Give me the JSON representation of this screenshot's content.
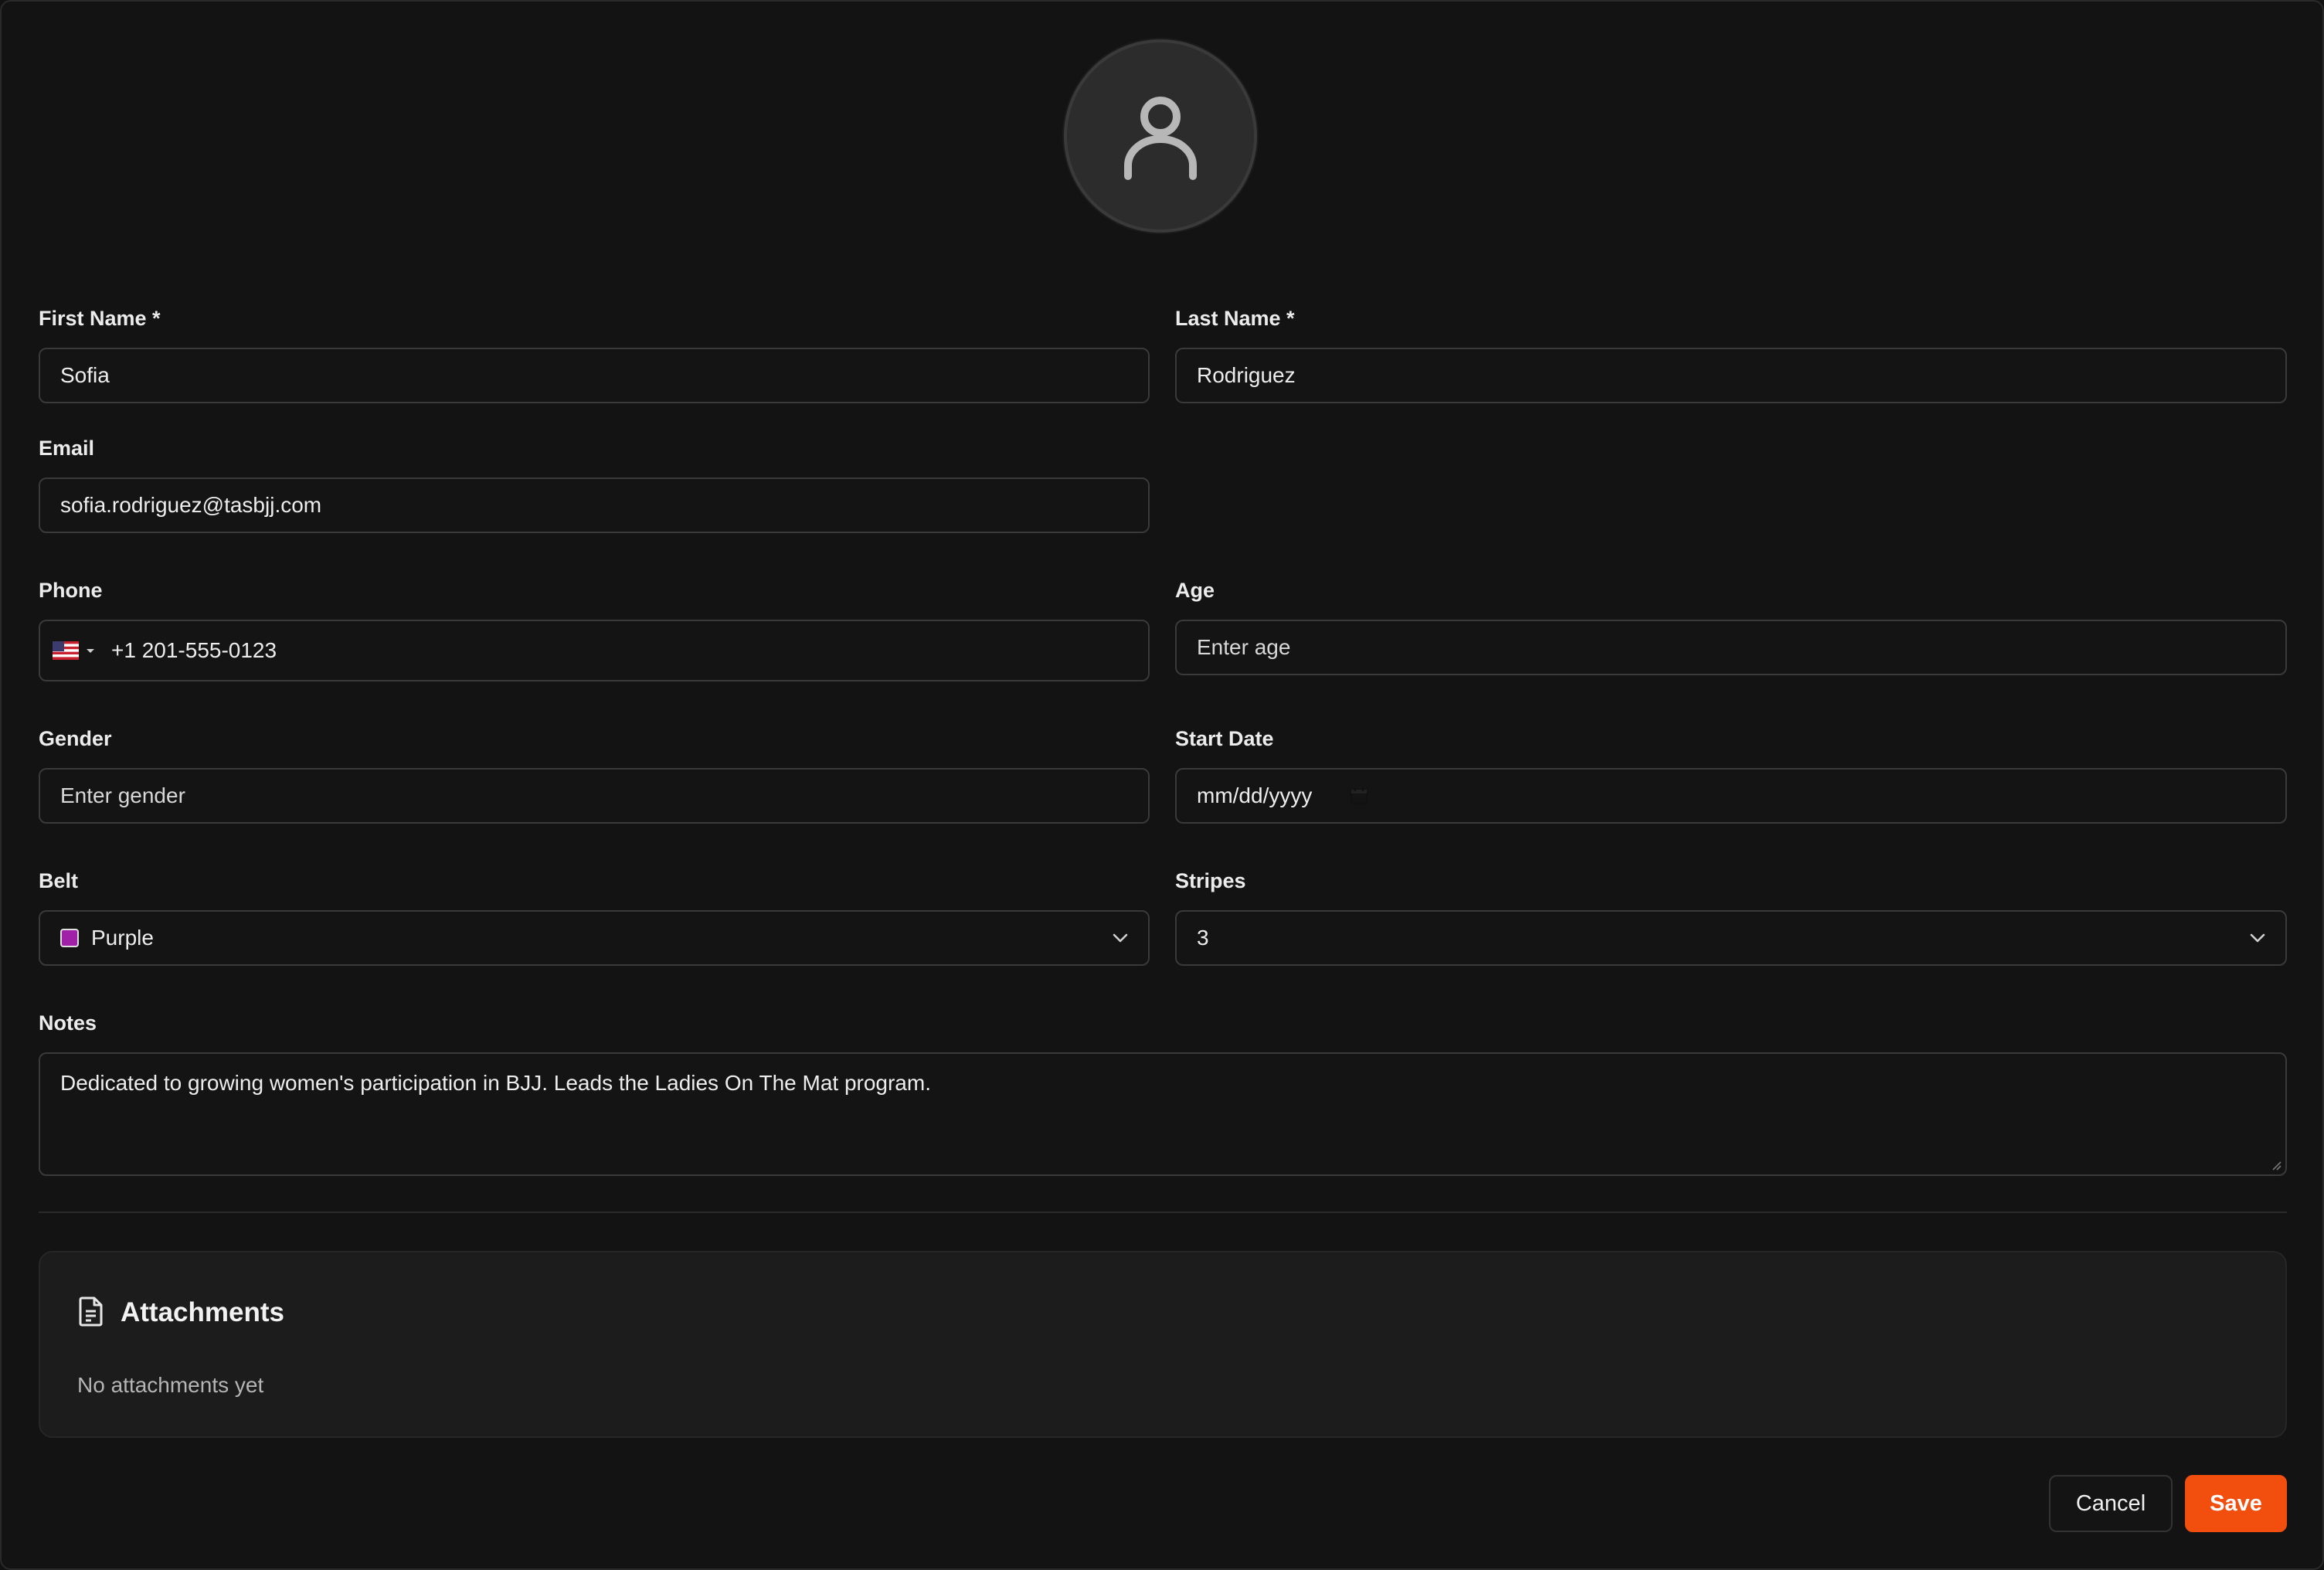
{
  "form": {
    "first_name": {
      "label": "First Name *",
      "value": "Sofia"
    },
    "last_name": {
      "label": "Last Name *",
      "value": "Rodriguez"
    },
    "email": {
      "label": "Email",
      "value": "sofia.rodriguez@tasbjj.com"
    },
    "phone": {
      "label": "Phone",
      "value": "+1 201-555-0123",
      "country_icon": "us-flag-icon"
    },
    "age": {
      "label": "Age",
      "placeholder": "Enter age"
    },
    "gender": {
      "label": "Gender",
      "placeholder": "Enter gender"
    },
    "start_date": {
      "label": "Start Date",
      "placeholder": "mm/dd/yyyy"
    },
    "belt": {
      "label": "Belt",
      "value": "Purple",
      "swatch_color": "#a020a8"
    },
    "stripes": {
      "label": "Stripes",
      "value": "3"
    },
    "notes": {
      "label": "Notes",
      "value": "Dedicated to growing women's participation in BJJ. Leads the Ladies On The Mat program."
    }
  },
  "attachments": {
    "title": "Attachments",
    "empty_text": "No attachments yet",
    "icon": "document-icon"
  },
  "actions": {
    "cancel_label": "Cancel",
    "save_label": "Save"
  },
  "colors": {
    "accent": "#f24e0e",
    "background": "#121212"
  }
}
